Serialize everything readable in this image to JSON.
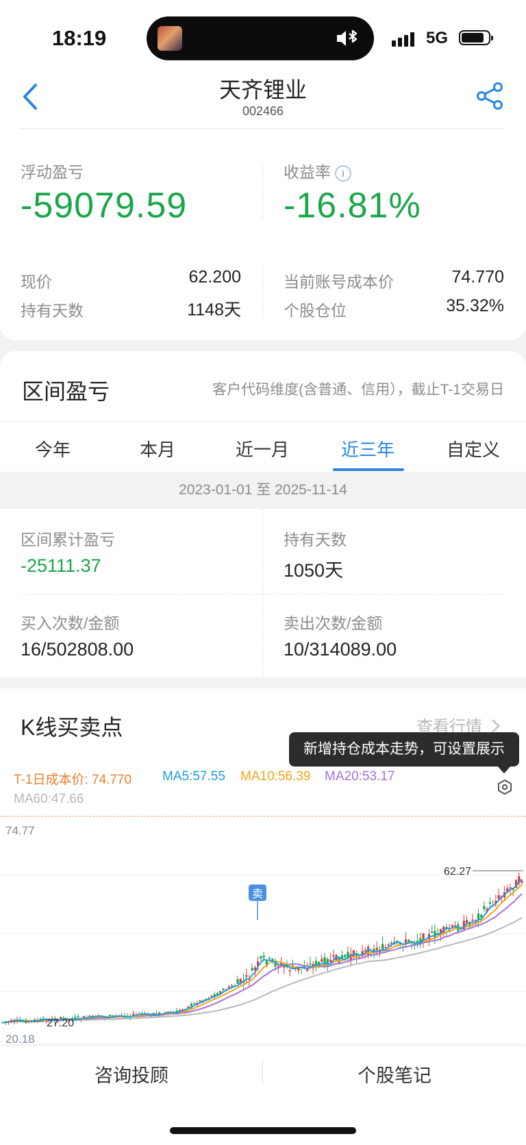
{
  "status_bar": {
    "time": "18:19",
    "network": "5G"
  },
  "header": {
    "title": "天齐锂业",
    "code": "002466"
  },
  "summary": {
    "floating_pl_label": "浮动盈亏",
    "floating_pl_value": "-59079.59",
    "return_rate_label": "收益率",
    "return_rate_value": "-16.81%",
    "info_icon": "i",
    "price_label": "现价",
    "price_value": "62.200",
    "hold_days_label": "持有天数",
    "hold_days_value": "1148天",
    "cost_label": "当前账号成本价",
    "cost_value": "74.770",
    "position_label": "个股仓位",
    "position_value": "35.32%"
  },
  "interval": {
    "title": "区间盈亏",
    "note": "客户代码维度(含普通、信用），截止T-1交易日",
    "tabs": [
      "今年",
      "本月",
      "近一月",
      "近三年",
      "自定义"
    ],
    "active_tab": 3,
    "date_range": "2023-01-01 至 2025-11-14",
    "cum_pl_label": "区间累计盈亏",
    "cum_pl_value": "-25111.37",
    "hold_days_label": "持有天数",
    "hold_days_value": "1050天",
    "buy_label": "买入次数/金额",
    "buy_value": "16/502808.00",
    "sell_label": "卖出次数/金额",
    "sell_value": "10/314089.00"
  },
  "kline": {
    "title": "K线买卖点",
    "view_link": "查看行情",
    "tooltip": "新增持仓成本走势，可设置展示",
    "cost_legend": "T-1日成本价: 74.770",
    "ma5": "MA5:57.55",
    "ma10": "MA10:56.39",
    "ma20": "MA20:53.17",
    "ma60": "MA60:47.66",
    "y_top": "74.77",
    "y_bottom": "20.18",
    "max_label": "62.27",
    "min_label": "27.20",
    "sell_marker": "卖",
    "colors": {
      "cost": "#e8802e",
      "ma5": "#1e9be0",
      "ma10": "#f2a516",
      "ma20": "#a76fe0",
      "ma60": "#b8b8b8",
      "up": "#e8333b",
      "down": "#1aa64a"
    }
  },
  "bottom": {
    "consult": "咨询投顾",
    "notes": "个股笔记"
  }
}
